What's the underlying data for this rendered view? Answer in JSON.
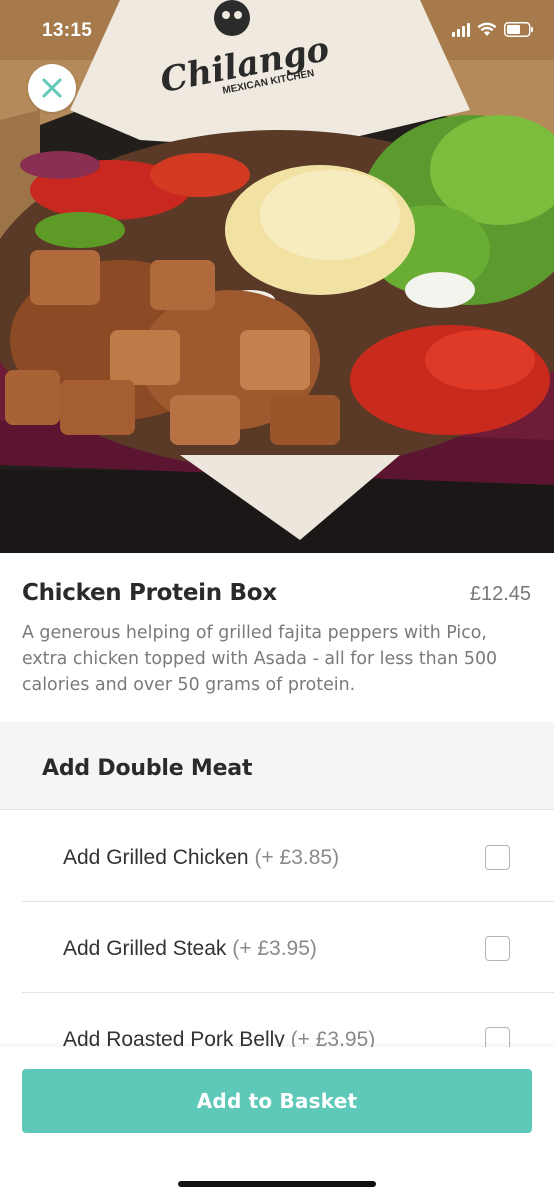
{
  "status_bar": {
    "time": "13:15"
  },
  "hero": {
    "brand_logo_text": "Chilango",
    "brand_logo_subtext": "MEXICAN KITCHEN",
    "close_icon": "close-icon"
  },
  "product": {
    "name": "Chicken Protein Box",
    "price": "£12.45",
    "description": "A generous helping of grilled fajita peppers with Pico, extra chicken topped with Asada - all for less than 500 calories and over 50 grams of protein."
  },
  "options_section": {
    "title": "Add Double Meat",
    "items": [
      {
        "label": "Add Grilled Chicken",
        "price": "(+ £3.85)",
        "checked": false
      },
      {
        "label": "Add Grilled Steak",
        "price": "(+ £3.95)",
        "checked": false
      },
      {
        "label": "Add Roasted Pork Belly",
        "price": "(+ £3.95)",
        "checked": false
      }
    ]
  },
  "footer": {
    "add_button_label": "Add to Basket"
  },
  "colors": {
    "accent": "#5ec9b8",
    "section_bg": "#f5f5f5",
    "box_maroon": "#7a1f3d"
  }
}
